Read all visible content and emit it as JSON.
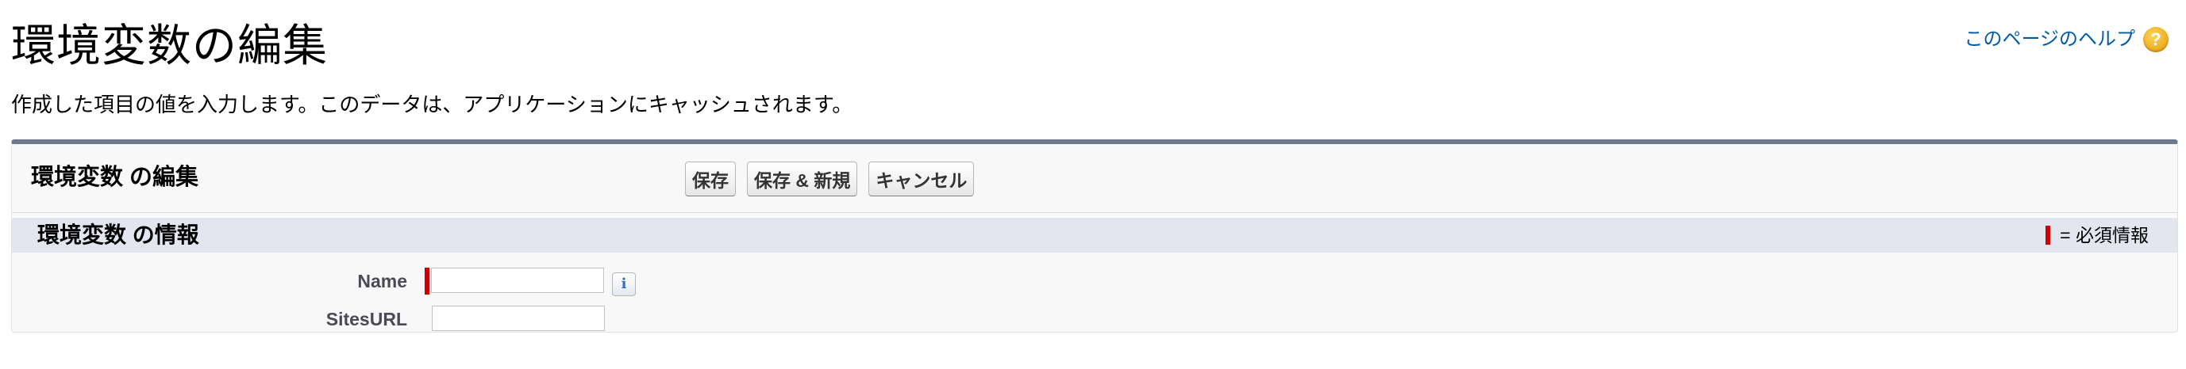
{
  "page": {
    "title": "環境変数の編集",
    "description": "作成した項目の値を入力します。このデータは、アプリケーションにキャッシュされます。",
    "help_link": "このページのヘルプ",
    "help_icon": "?"
  },
  "panel": {
    "title": "環境変数 の編集",
    "buttons": {
      "save": "保存",
      "save_new": "保存 & 新規",
      "cancel": "キャンセル"
    },
    "section": {
      "title": "環境変数 の情報",
      "required_legend": "= 必須情報"
    },
    "fields": [
      {
        "label": "Name",
        "value": "",
        "required": true
      },
      {
        "label": "SitesURL",
        "value": "",
        "required": false
      }
    ],
    "info_icon": "i"
  },
  "colors": {
    "link": "#015ba7",
    "required": "#cc0000",
    "panel_border": "#6d7a8e",
    "section_bg": "#e3e6ee"
  }
}
